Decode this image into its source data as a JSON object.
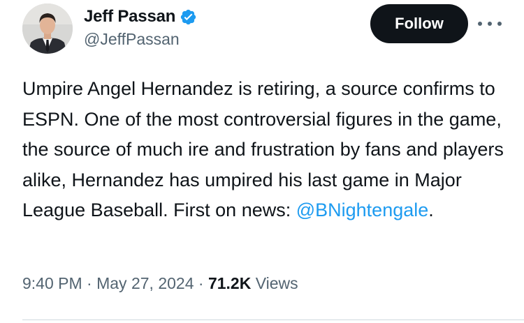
{
  "author": {
    "display_name": "Jeff Passan",
    "handle": "@JeffPassan",
    "verified": true,
    "verified_color": "#1d9bf0"
  },
  "actions": {
    "follow_label": "Follow",
    "more_icon": "more-horizontal-icon"
  },
  "tweet": {
    "text_before_mention": "Umpire Angel Hernandez is retiring, a source confirms to ESPN. One of the most controversial figures in the game, the source of much ire and frustration by fans and players alike, Hernandez has umpired his last game in Major League Baseball. First on news: ",
    "mention": "@BNightengale",
    "text_after_mention": ".",
    "mention_color": "#1d9bf0"
  },
  "meta": {
    "time": "9:40 PM",
    "separator": " · ",
    "date": "May 27, 2024",
    "views_count": "71.2K",
    "views_label": "Views"
  }
}
